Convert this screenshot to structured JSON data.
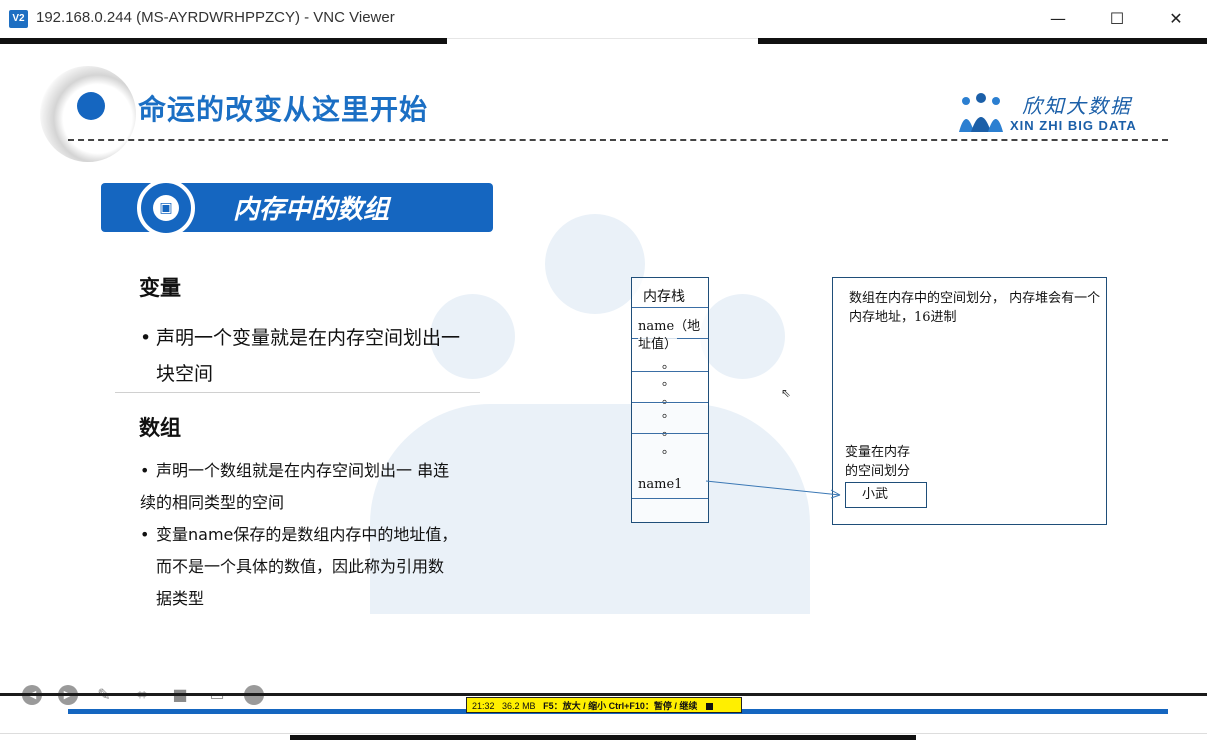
{
  "window": {
    "title": "192.168.0.244 (MS-AYRDWRHPPZCY) - VNC Viewer",
    "app_icon": "V2",
    "minimize_label": "—",
    "maximize_label": "☐",
    "close_label": "✕"
  },
  "slide": {
    "title": "命运的改变从这里开始",
    "logo_cn": "欣知大数据",
    "logo_en": "XIN ZHI BIG DATA",
    "section_title": "内存中的数组",
    "variable": {
      "heading": "变量",
      "bullet1_line1": "声明一个变量就是在内存空间划出一",
      "bullet1_line2": "块空间"
    },
    "array": {
      "heading": "数组",
      "bullet1_line1": "声明一个数组就是在内存空间划出一  串连",
      "bullet1_line2": "续的相同类型的空间",
      "bullet2_line1": "变量name保存的是数组内存中的地址值，",
      "bullet2_line2": "而不是一个具体的数值，因此称为引用数",
      "bullet2_line3": "据类型"
    },
    "bullet_symbol": "•",
    "stack": {
      "label": "内存栈",
      "row_name_line1": "name（地",
      "row_name_line2": "址值）",
      "ellipsis_rows": [
        "。",
        "。",
        "。",
        "。",
        "。",
        "。"
      ],
      "row_name1": "name1"
    },
    "heap": {
      "description": "数组在内存中的空间划分，  内存堆会有一个内存地址，16进制",
      "sub_label_line1": "变量在内存",
      "sub_label_line2": "的空间划分",
      "value": "小武"
    }
  },
  "status_bar": {
    "time": "21:32",
    "memory": "36.2 MB",
    "hint": "F5：放大 / 缩小 Ctrl+F10：暂停 / 继续"
  },
  "colors": {
    "accent_blue": "#1566c0",
    "status_yellow": "#ffef00"
  },
  "toolbar_icons": [
    "back-icon",
    "forward-icon",
    "pen-icon",
    "screenshot-icon",
    "camera-icon",
    "comment-icon",
    "circle-icon"
  ]
}
